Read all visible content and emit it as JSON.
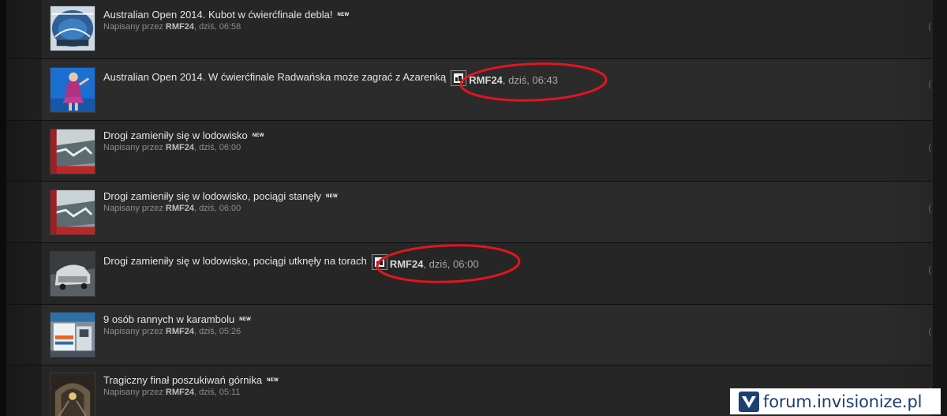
{
  "topics": [
    {
      "title": "Australian Open 2014. Kubot w ćwierćfinale debla!",
      "is_new": true,
      "new_label": "NEW",
      "meta_prefix": "Napisany przez",
      "author": "RMF24",
      "time": ", dziś, 06:58",
      "inline_meta": false,
      "thumb_icon": "tennis-court-thumbnail",
      "edge": "(",
      "alt": false
    },
    {
      "title": "Australian Open 2014. W ćwierćfinale Radwańska może zagrać z Azarenką",
      "is_new": false,
      "new_label": "",
      "meta_prefix": "",
      "author": "RMF24",
      "time": ", dziś, 06:43",
      "inline_meta": true,
      "thumb_icon": "tennis-player-thumbnail",
      "edge": "(",
      "alt": true
    },
    {
      "title": "Drogi zamieniły się w lodowisko",
      "is_new": true,
      "new_label": "NEW",
      "meta_prefix": "Napisany przez",
      "author": "RMF24",
      "time": ", dziś, 06:00",
      "inline_meta": false,
      "thumb_icon": "icy-road-thumbnail",
      "edge": "(",
      "alt": false
    },
    {
      "title": "Drogi zamieniły się w lodowisko, pociągi stanęły",
      "is_new": true,
      "new_label": "NEW",
      "meta_prefix": "Napisany przez",
      "author": "RMF24",
      "time": ", dziś, 06:00",
      "inline_meta": false,
      "thumb_icon": "icy-road-thumbnail",
      "edge": "(",
      "alt": true
    },
    {
      "title": "Drogi zamieniły się w lodowisko, pociągi utknęły na torach",
      "is_new": false,
      "new_label": "",
      "meta_prefix": "",
      "author": "RMF24",
      "time": ", dziś, 06:00",
      "inline_meta": true,
      "thumb_icon": "snowy-car-thumbnail",
      "edge": "(",
      "alt": false
    },
    {
      "title": "9 osób rannych w karambolu",
      "is_new": true,
      "new_label": "NEW",
      "meta_prefix": "Napisany przez",
      "author": "RMF24",
      "time": ", dziś, 05:26",
      "inline_meta": false,
      "thumb_icon": "ambulance-thumbnail",
      "edge": "(",
      "alt": true
    },
    {
      "title": "Tragiczny finał poszukiwań górnika",
      "is_new": true,
      "new_label": "NEW",
      "meta_prefix": "Napisany przez",
      "author": "RMF24",
      "time": ", dziś, 05:11",
      "inline_meta": false,
      "thumb_icon": "mine-tunnel-thumbnail",
      "edge": "(",
      "alt": false
    }
  ],
  "annotation_color": "#e2151f",
  "watermark": {
    "text": "forum.invisionize.pl",
    "icon": "invisionize-logo-icon",
    "color": "#1d3f73"
  }
}
